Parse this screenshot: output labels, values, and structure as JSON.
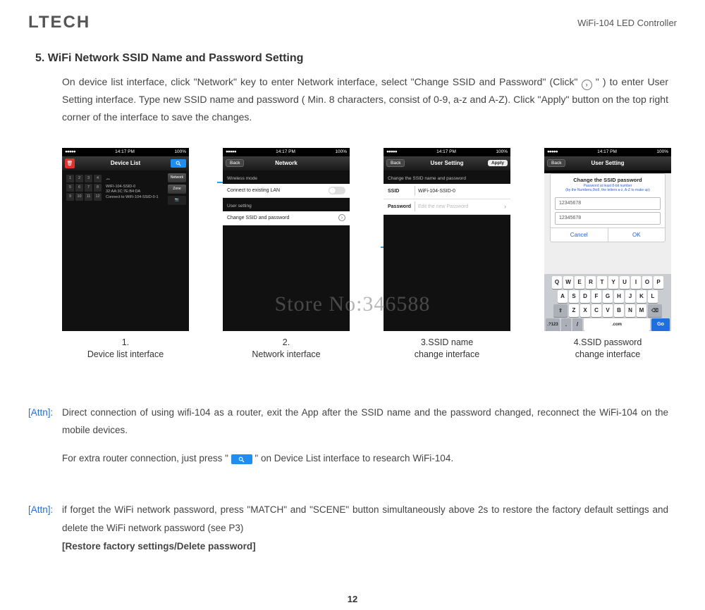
{
  "header": {
    "logo": "LTECH",
    "product": "WiFi-104 LED Controller"
  },
  "section": {
    "title": "5. WiFi Network SSID Name and Password Setting",
    "body_a": "On device list interface, click \"Network\" key to enter Network interface, select \"Change SSID and Password\" (Click\"",
    "body_b": "\" ) to enter User Setting interface. Type new SSID name and password ( Min. 8 characters, consist of 0-9, a-z and A-Z). Click \"Apply\" button on the top right corner of the interface to save the changes."
  },
  "status": {
    "time": "14:17 PM",
    "batt": "100%"
  },
  "screen1": {
    "title": "Device List",
    "cells": [
      "1",
      "2",
      "3",
      "4",
      "5",
      "6",
      "7",
      "8",
      "9",
      "10",
      "11",
      "12"
    ],
    "ssid": "WIFI-104-SSID-0",
    "mac": "32:AA:3C:7E:B4:DA",
    "conn": "Connect to WiFi-104-SSID-0-1",
    "btn_network": "Network",
    "btn_zone": "Zone",
    "caption": "1.\nDevice list interface"
  },
  "screen2": {
    "back": "Back",
    "title": "Network",
    "sect1": "Wireless mode",
    "row1": "Connect to existing LAN",
    "sect2": "User setting",
    "row2": "Change SSID and password",
    "caption": "2.\nNetwork interface"
  },
  "screen3": {
    "back": "Back",
    "title": "User Setting",
    "apply": "Apply",
    "hint": "Change the SSID name and password",
    "lbl_ssid": "SSID",
    "val_ssid": "WiFi-104-SSID-0",
    "lbl_pw": "Password",
    "ph_pw": "Edit the new Password",
    "caption": "3.SSID name\nchange  interface"
  },
  "screen4": {
    "back": "Back",
    "title": "User Setting",
    "dlg_title": "Change the SSID password",
    "dlg_sub": "Password at least 8-bit number\n(by the Numbers,0to9, the letters a-z, A-Z to make up)",
    "in1": "12345678",
    "in2": "12345678",
    "cancel": "Cancel",
    "ok": "OK",
    "go": "Go",
    "caption": "4.SSID password\nchange  interface"
  },
  "watermark": "Store No:346588",
  "attn1": {
    "tag": "Attn",
    "p1": "Direct connection of using wifi-104 as a router, exit the App after the SSID name and the password changed, reconnect the WiFi-104 on the mobile devices.",
    "p2a": "For extra router connection, just press  \" ",
    "p2b": " \" on Device List interface to research WiFi-104."
  },
  "attn2": {
    "tag": "Attn",
    "p1": "if forget the WiFi network password, press \"MATCH\" and \"SCENE\" button simultaneously above 2s to restore the factory default settings and delete the WiFi network password (see P3)",
    "p2": "[Restore factory settings/Delete password]"
  },
  "page": "12",
  "kbd": {
    "r1": [
      "Q",
      "W",
      "E",
      "R",
      "T",
      "Y",
      "U",
      "I",
      "O",
      "P"
    ],
    "r2": [
      "A",
      "S",
      "D",
      "F",
      "G",
      "H",
      "J",
      "K",
      "L"
    ],
    "r3": [
      "Z",
      "X",
      "C",
      "V",
      "B",
      "N",
      "M"
    ]
  }
}
